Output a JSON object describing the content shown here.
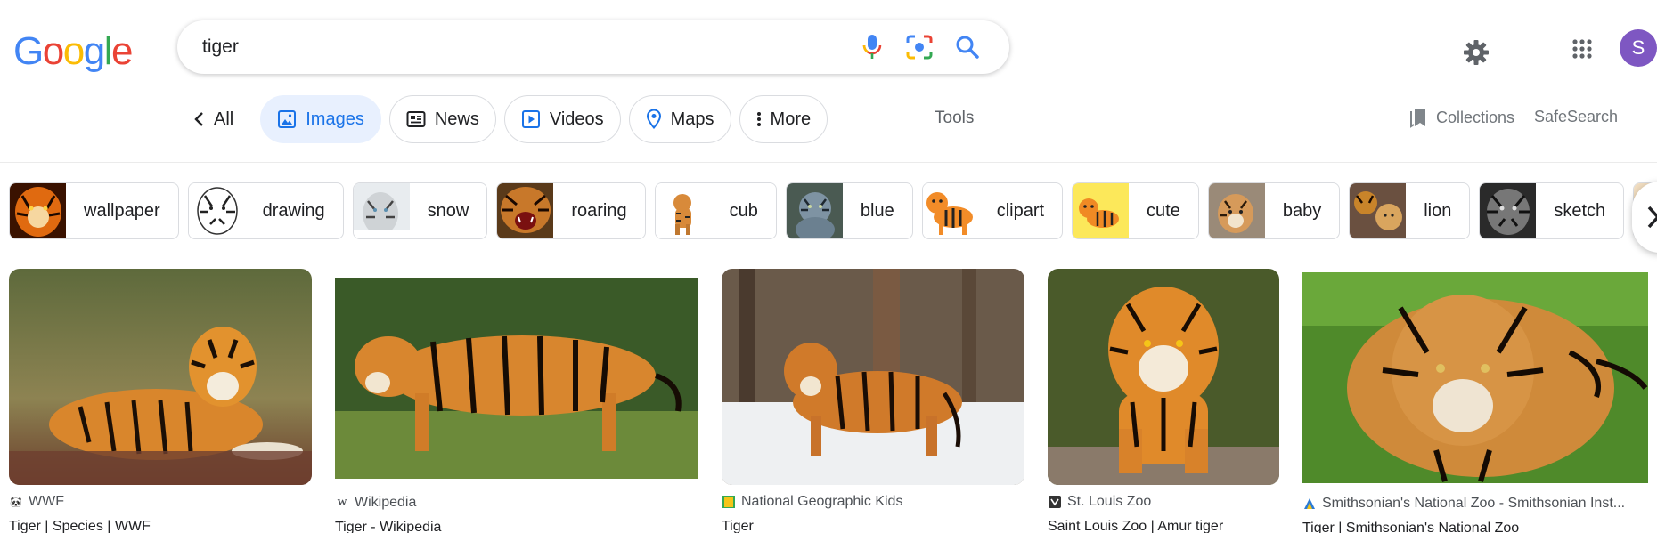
{
  "logo": {
    "text": [
      "G",
      "o",
      "o",
      "g",
      "l",
      "e"
    ],
    "colors": [
      "#4285F4",
      "#EA4335",
      "#FBBC05",
      "#4285F4",
      "#34A853",
      "#EA4335"
    ]
  },
  "search": {
    "value": "tiger"
  },
  "avatar": {
    "initial": "S"
  },
  "tabs": [
    {
      "label": "All",
      "icon": "back-arrow-icon"
    },
    {
      "label": "Images",
      "icon": "image-icon",
      "active": true
    },
    {
      "label": "News",
      "icon": "news-icon"
    },
    {
      "label": "Videos",
      "icon": "video-icon"
    },
    {
      "label": "Maps",
      "icon": "map-pin-icon"
    },
    {
      "label": "More",
      "icon": "more-vert-icon"
    }
  ],
  "tools_label": "Tools",
  "collections_label": "Collections",
  "safesearch_label": "SafeSearch",
  "chips": [
    "wallpaper",
    "drawing",
    "snow",
    "roaring",
    "cub",
    "blue",
    "clipart",
    "cute",
    "baby",
    "lion",
    "sketch"
  ],
  "results": [
    {
      "source": "WWF",
      "title": "Tiger | Species | WWF",
      "favicon": "panda-icon"
    },
    {
      "source": "Wikipedia",
      "title": "Tiger - Wikipedia",
      "favicon": "wikipedia-icon"
    },
    {
      "source": "National Geographic Kids",
      "title": "Tiger",
      "favicon": "natgeo-icon"
    },
    {
      "source": "St. Louis Zoo",
      "title": "Saint Louis Zoo | Amur tiger",
      "favicon": "stlzoo-icon"
    },
    {
      "source": "Smithsonian's National Zoo - Smithsonian Inst...",
      "title": "Tiger | Smithsonian's National Zoo",
      "favicon": "smithsonian-icon"
    }
  ],
  "colors": {
    "accent": "#1a73e8",
    "active_tab_bg": "#e8f0fe",
    "avatar_bg": "#7e57c2"
  }
}
